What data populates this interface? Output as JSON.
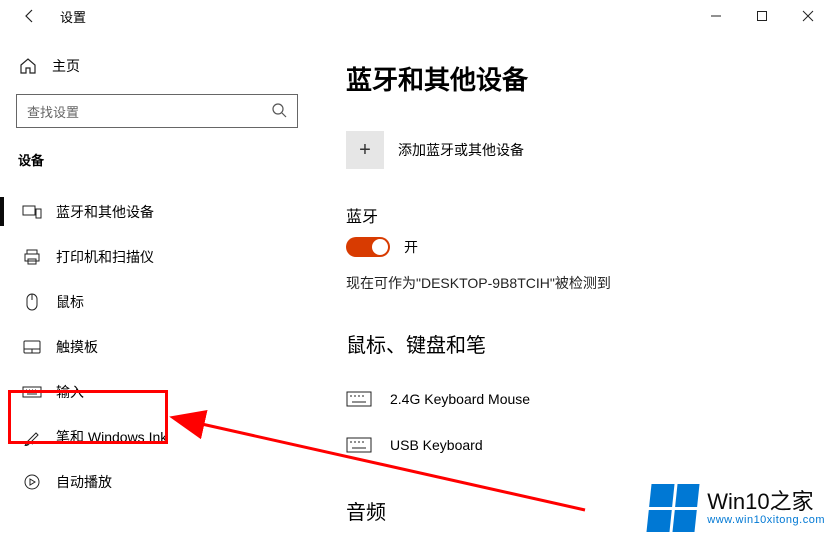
{
  "titlebar": {
    "title": "设置"
  },
  "sidebar": {
    "home": "主页",
    "search_placeholder": "查找设置",
    "section": "设备",
    "items": [
      {
        "label": "蓝牙和其他设备"
      },
      {
        "label": "打印机和扫描仪"
      },
      {
        "label": "鼠标"
      },
      {
        "label": "触摸板"
      },
      {
        "label": "输入"
      },
      {
        "label": "笔和 Windows Ink"
      },
      {
        "label": "自动播放"
      }
    ]
  },
  "main": {
    "title": "蓝牙和其他设备",
    "add_device": "添加蓝牙或其他设备",
    "bluetooth_label": "蓝牙",
    "toggle_state": "开",
    "discover_text": "现在可作为\"DESKTOP-9B8TCIH\"被检测到",
    "section_mouse": "鼠标、键盘和笔",
    "devices": [
      {
        "name": "2.4G Keyboard Mouse"
      },
      {
        "name": "USB Keyboard"
      }
    ],
    "section_audio": "音频"
  },
  "watermark": {
    "brand": "Win10之家",
    "url": "www.win10xitong.com"
  }
}
